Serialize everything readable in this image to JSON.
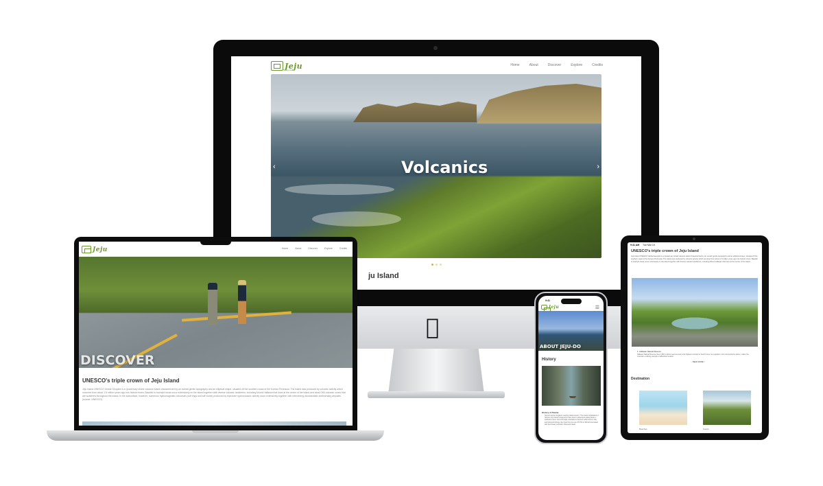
{
  "brand": {
    "name": "Jeju",
    "tagline": "Jeju Island"
  },
  "nav": {
    "items": [
      "Home",
      "About",
      "Discover",
      "Explore",
      "Credits"
    ]
  },
  "desktop": {
    "hero_title": "Volcanics",
    "prev_arrow": "‹",
    "next_arrow": "›",
    "section_heading": "ju Island"
  },
  "laptop": {
    "hero_title": "DISCOVER",
    "section_heading": "UNESCO's triple crown of Jeju Island",
    "body": "Jeju Island UNESCO Global Geopark is a Quaternary shield volcanic island characterized by an overall gentle topography and an elliptical shape, situated off the southern coast of the Korean Peninsula. The island was produced by volcanic activity which occurred from about 1.8 million years ago into historic times. Basaltic to trachytic lavas occur extensively on the island together with diverse volcanic landforms, including Mount Hallasan that rises at the center of the island and about 360 volcanic cones that are scattered throughout the island. In the subsurface, however, numerous hydromagmatic volcanoes (tuff rings and tuff cones) produced by explosive hydrovolcanic activity occur extensively together with intervening volcaniclastic sedimentary deposits. (source: UNESCO)"
  },
  "tablet": {
    "status_time": "9:41 AM",
    "status_date": "Tue Mar 15",
    "section_heading": "UNESCO's triple crown of Jeju Island",
    "body": "Jeju Island UNESCO Global Geopark is a Quaternary shield volcanic island characterized by an overall gentle topography and an elliptical shape, situated off the southern coast of the Korean Peninsula. The island was produced by volcanic activity which occurred from about 1.8 million years ago into historic times. Basaltic to trachytic lavas occur extensively on the island together with diverse volcanic landforms, including Mount Hallasan that rises at the center of the island.",
    "caption_title": "1. Hallasan Natural Reserve",
    "caption_text": "Hallasan Natural Reserve rises 1,950 m above sea level and is the highest mountain in South Korea. Its vegetation, from sub-tropical to alpine, makes the mountain a striking example of altitudinal zonation.",
    "read_more": "... READ MORE >",
    "destination_heading": "Destination",
    "dest_1": "Beaches",
    "dest_2": "Forest"
  },
  "phone": {
    "status_time": "9:41",
    "hero_title": "ABOUT JEJU-DO",
    "section_heading": "History",
    "sub_heading": "History of Tamna",
    "body": "Tamna's ancient kingdom meaning 'island country'. The ancient inhabitants of Tamna in the island is believed to have lived in settlements dating back to prehistoric times. Found through excavations of ancient settlements in clay, and historical writings, they lived from the era of 57 BC to 938 AD and traded with the Korean peninsula, China and Japan."
  },
  "colors": {
    "brand_green": "#6a9a2b",
    "dot_active": "#d6b24a"
  }
}
